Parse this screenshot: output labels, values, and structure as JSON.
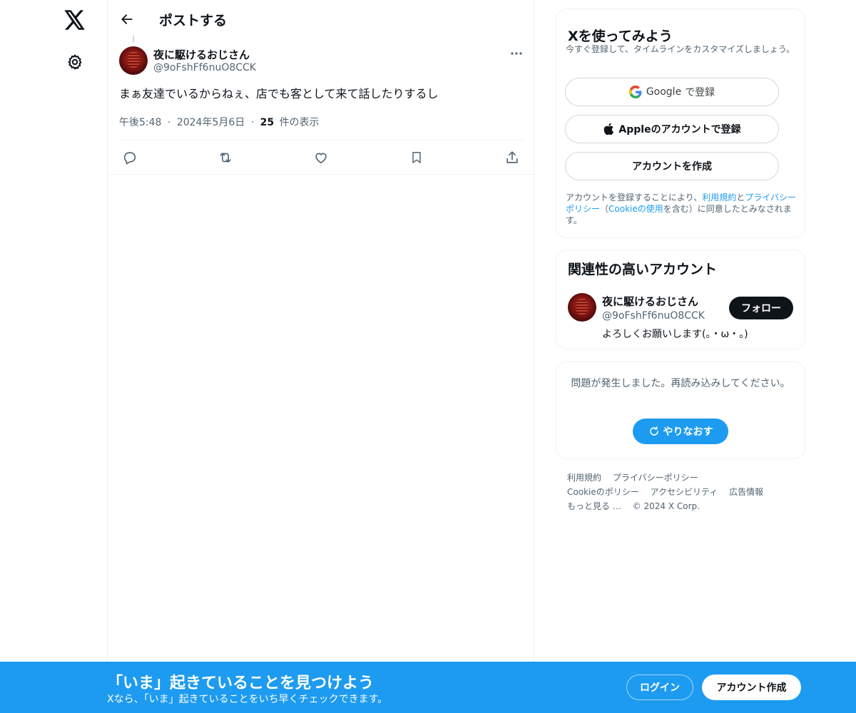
{
  "rail": {
    "logo_icon": "x-logo-icon",
    "settings_icon": "gear-icon"
  },
  "header": {
    "title": "ポストする",
    "back_icon": "arrow-left-icon"
  },
  "post": {
    "author_name": "夜に駆けるおじさん",
    "author_handle": "@9oFshFf6nuO8CCK",
    "text": "まぁ友達でいるからねぇ、店でも客として来て話したりするし",
    "time": "午後5:48",
    "date": "2024年5月6日",
    "sep": "·",
    "views_count": "25",
    "views_label": "件の表示",
    "actions": [
      "reply-icon",
      "repost-icon",
      "like-icon",
      "bookmark-icon",
      "share-icon"
    ]
  },
  "signup": {
    "title": "Xを使ってみよう",
    "subtitle": "今すぐ登録して、タイムラインをカスタマイズしましょう。",
    "google_word": "Google",
    "google_label": "で登録",
    "apple_label": "Appleのアカウントで登録",
    "create_label": "アカウントを作成",
    "terms_prefix": "アカウントを登録することにより、",
    "terms_link1": "利用規約",
    "terms_and": "と",
    "terms_link2": "プライバシーポリシー",
    "terms_open": "（",
    "terms_link3": "Cookieの使用",
    "terms_suffix": "を含む）に同意したとみなされます。"
  },
  "related": {
    "title": "関連性の高いアカウント",
    "name": "夜に駆けるおじさん",
    "handle": "@9oFshFf6nuO8CCK",
    "bio": "よろしくお願いします(。・ω・。)",
    "follow_label": "フォロー"
  },
  "error": {
    "message": "問題が発生しました。再読み込みしてください。",
    "retry_label": "やりなおす"
  },
  "footer": {
    "links_row1": [
      "利用規約",
      "プライバシーポリシー"
    ],
    "links_row2": [
      "Cookieのポリシー",
      "アクセシビリティ",
      "広告情報"
    ],
    "more": "もっと見る …",
    "copyright": "© 2024 X Corp."
  },
  "banner": {
    "title": "「いま」起きていることを見つけよう",
    "subtitle": "Xなら、「いま」起きていることをいち早くチェックできます。",
    "login_label": "ログイン",
    "signup_label": "アカウント作成"
  },
  "colors": {
    "accent": "#1d9bf0",
    "text": "#0f1419",
    "muted": "#536471",
    "border": "#eff3f4"
  }
}
